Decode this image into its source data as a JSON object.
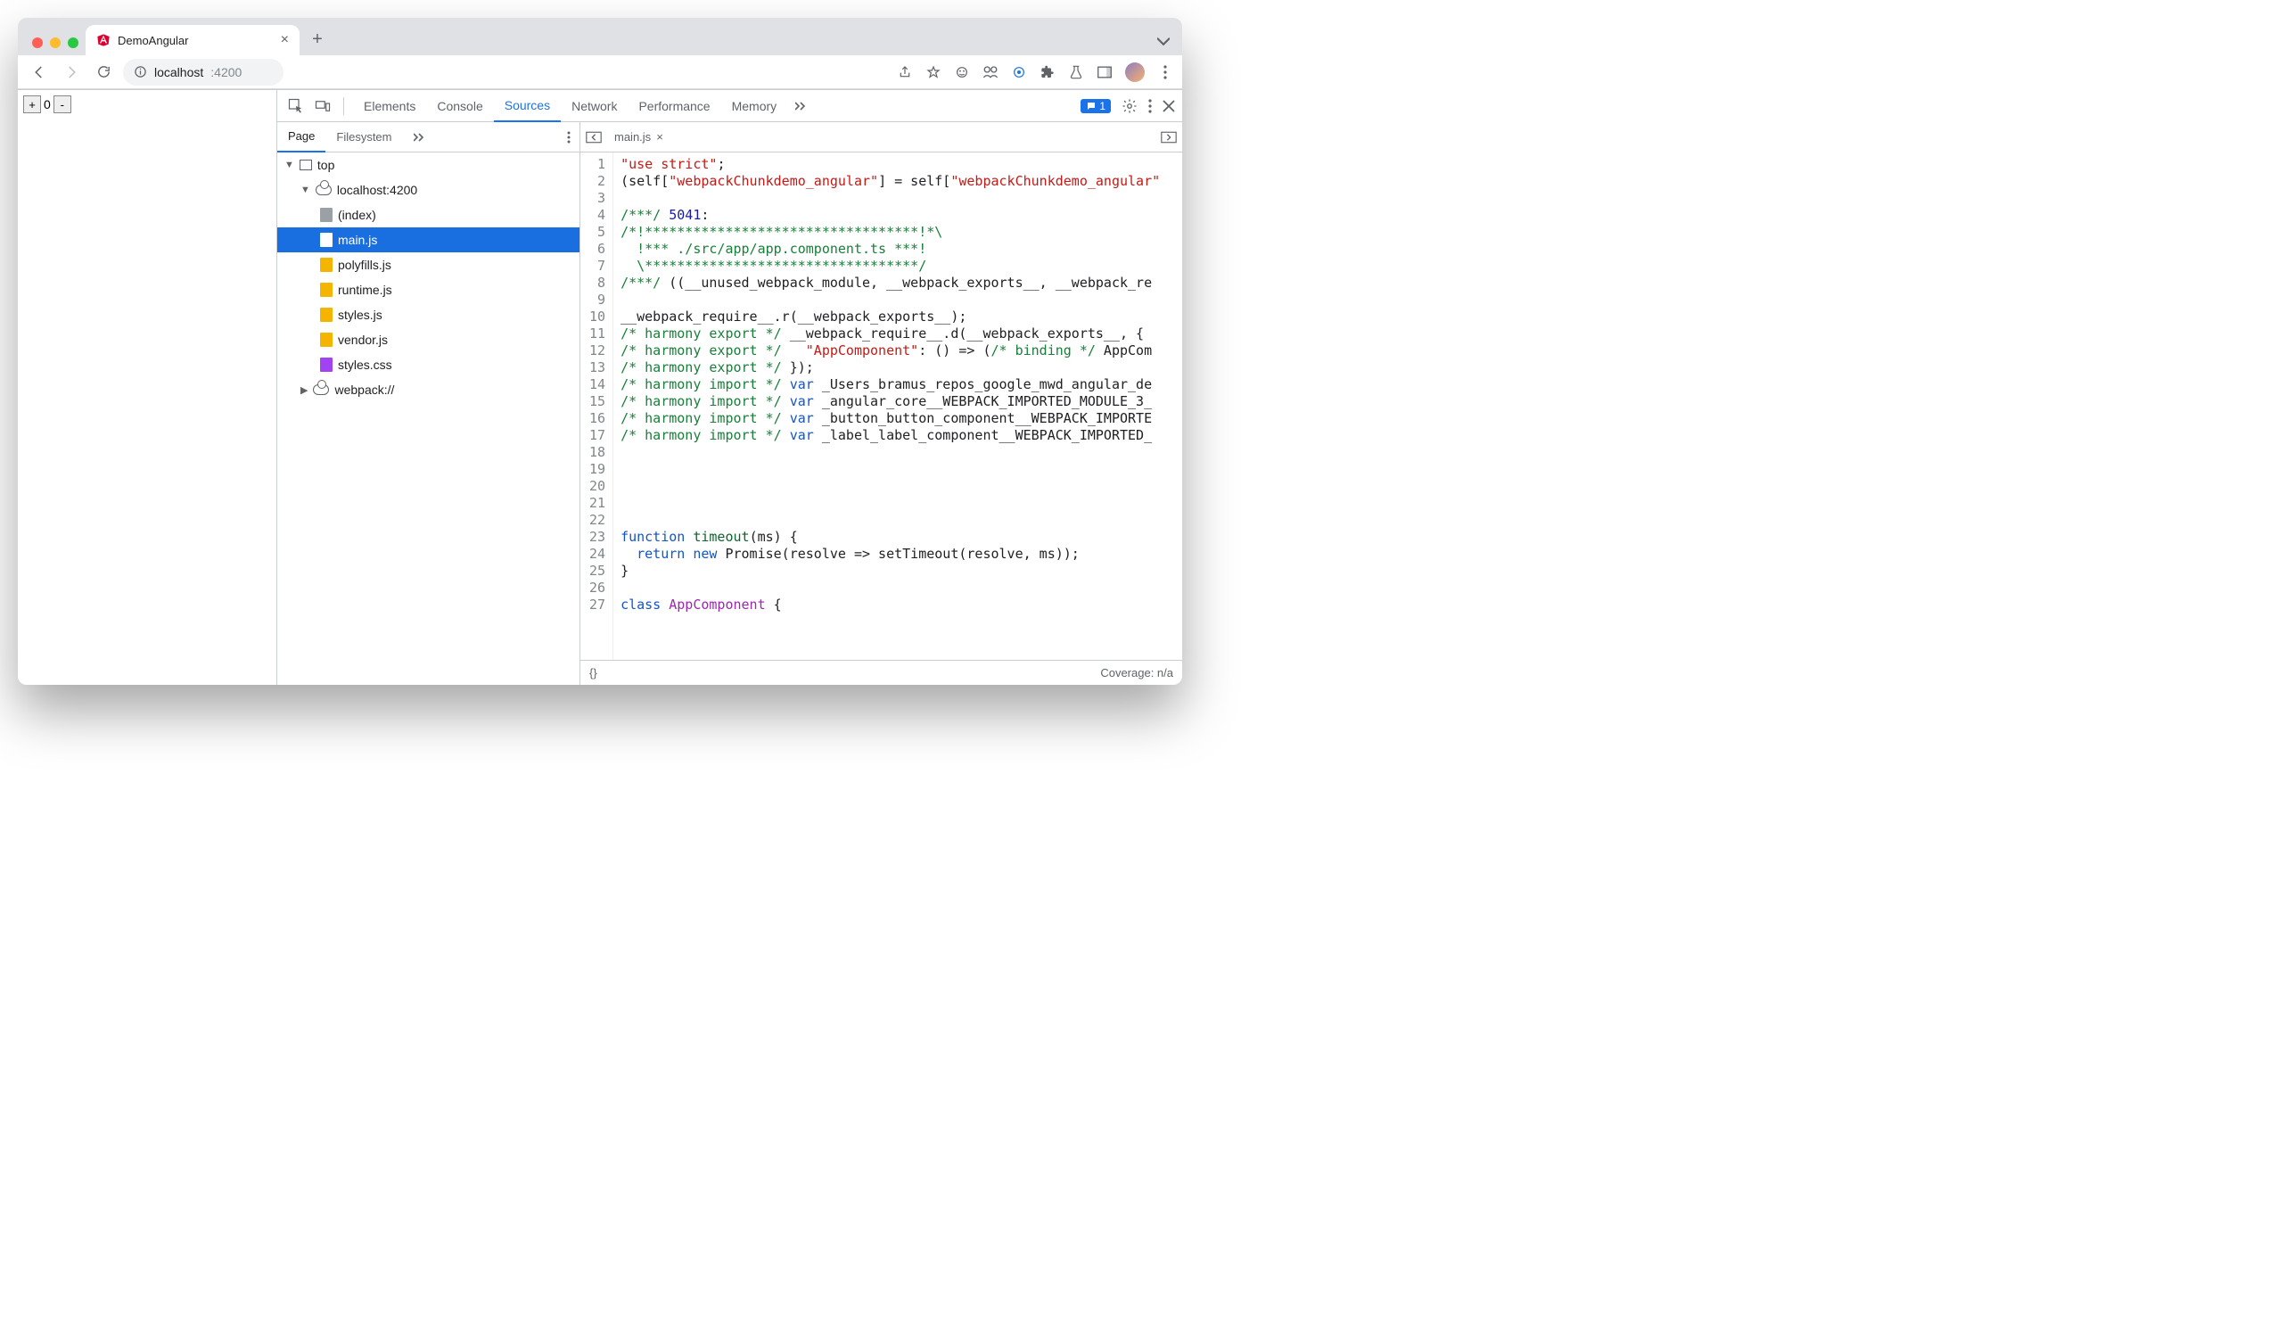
{
  "browser": {
    "tab_title": "DemoAngular",
    "url_host": "localhost",
    "url_port": ":4200"
  },
  "page": {
    "counter": "0"
  },
  "devtools": {
    "tabs": [
      "Elements",
      "Console",
      "Sources",
      "Network",
      "Performance",
      "Memory"
    ],
    "active_tab": "Sources",
    "issues_badge": "1",
    "navigator": {
      "tabs": [
        "Page",
        "Filesystem"
      ],
      "active": "Page",
      "tree": {
        "top_label": "top",
        "origin_label": "localhost:4200",
        "files": [
          {
            "name": "(index)",
            "type": "doc"
          },
          {
            "name": "main.js",
            "type": "js",
            "selected": true
          },
          {
            "name": "polyfills.js",
            "type": "js"
          },
          {
            "name": "runtime.js",
            "type": "js"
          },
          {
            "name": "styles.js",
            "type": "js"
          },
          {
            "name": "vendor.js",
            "type": "js"
          },
          {
            "name": "styles.css",
            "type": "css"
          }
        ],
        "webpack_label": "webpack://"
      }
    },
    "editor": {
      "open_file": "main.js",
      "footer_left": "{}",
      "footer_right": "Coverage: n/a"
    }
  },
  "code": {
    "lines": [
      [
        {
          "t": "\"use strict\"",
          "c": "c-str"
        },
        {
          "t": ";"
        }
      ],
      [
        {
          "t": "(self["
        },
        {
          "t": "\"webpackChunkdemo_angular\"",
          "c": "c-str"
        },
        {
          "t": "] = self["
        },
        {
          "t": "\"webpackChunkdemo_angular\"",
          "c": "c-str"
        }
      ],
      [],
      [
        {
          "t": "/***/",
          "c": "c-comm"
        },
        {
          "t": " "
        },
        {
          "t": "5041",
          "c": "c-num"
        },
        {
          "t": ":"
        }
      ],
      [
        {
          "t": "/*!**********************************!*\\",
          "c": "c-comm"
        }
      ],
      [
        {
          "t": "  !*** ./src/app/app.component.ts ***!",
          "c": "c-comm"
        }
      ],
      [
        {
          "t": "  \\**********************************/",
          "c": "c-comm"
        }
      ],
      [
        {
          "t": "/***/",
          "c": "c-comm"
        },
        {
          "t": " ((__unused_webpack_module, __webpack_exports__, __webpack_re"
        }
      ],
      [],
      [
        {
          "t": "__webpack_require__.r(__webpack_exports__);"
        }
      ],
      [
        {
          "t": "/* harmony export */",
          "c": "c-comm"
        },
        {
          "t": " __webpack_require__.d(__webpack_exports__, {"
        }
      ],
      [
        {
          "t": "/* harmony export */",
          "c": "c-comm"
        },
        {
          "t": "   "
        },
        {
          "t": "\"AppComponent\"",
          "c": "c-str"
        },
        {
          "t": ": () => ("
        },
        {
          "t": "/* binding */",
          "c": "c-comm"
        },
        {
          "t": " AppCom"
        }
      ],
      [
        {
          "t": "/* harmony export */",
          "c": "c-comm"
        },
        {
          "t": " });"
        }
      ],
      [
        {
          "t": "/* harmony import */",
          "c": "c-comm"
        },
        {
          "t": " "
        },
        {
          "t": "var",
          "c": "c-def"
        },
        {
          "t": " _Users_bramus_repos_google_mwd_angular_de"
        }
      ],
      [
        {
          "t": "/* harmony import */",
          "c": "c-comm"
        },
        {
          "t": " "
        },
        {
          "t": "var",
          "c": "c-def"
        },
        {
          "t": " _angular_core__WEBPACK_IMPORTED_MODULE_3_"
        }
      ],
      [
        {
          "t": "/* harmony import */",
          "c": "c-comm"
        },
        {
          "t": " "
        },
        {
          "t": "var",
          "c": "c-def"
        },
        {
          "t": " _button_button_component__WEBPACK_IMPORTE"
        }
      ],
      [
        {
          "t": "/* harmony import */",
          "c": "c-comm"
        },
        {
          "t": " "
        },
        {
          "t": "var",
          "c": "c-def"
        },
        {
          "t": " _label_label_component__WEBPACK_IMPORTED_"
        }
      ],
      [],
      [],
      [],
      [],
      [],
      [
        {
          "t": "function",
          "c": "c-def"
        },
        {
          "t": " "
        },
        {
          "t": "timeout",
          "c": "c-fn"
        },
        {
          "t": "(ms) {"
        }
      ],
      [
        {
          "t": "  "
        },
        {
          "t": "return",
          "c": "c-def"
        },
        {
          "t": " "
        },
        {
          "t": "new",
          "c": "c-def"
        },
        {
          "t": " Promise(resolve => setTimeout(resolve, ms));"
        }
      ],
      [
        {
          "t": "}"
        }
      ],
      [],
      [
        {
          "t": "class",
          "c": "c-def"
        },
        {
          "t": " "
        },
        {
          "t": "AppComponent",
          "c": "c-kw"
        },
        {
          "t": " {"
        }
      ]
    ]
  }
}
